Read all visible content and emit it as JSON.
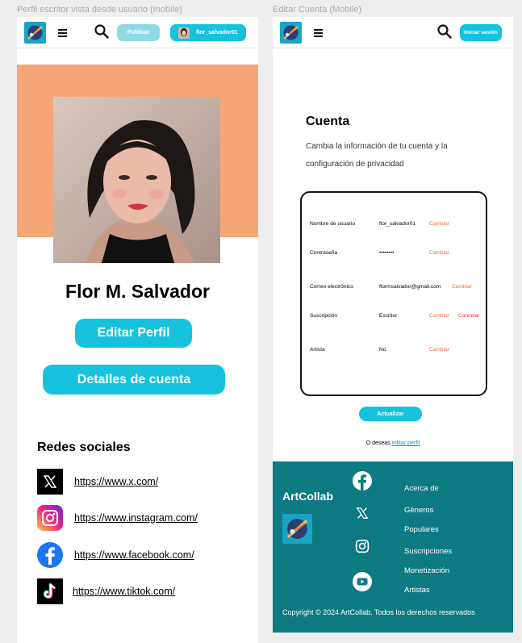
{
  "frames": {
    "profile_title": "Perfil escritor vista desde usuario (mobile)",
    "account_title": "Editar Cuenta (Mobile)"
  },
  "colors": {
    "accent": "#16c2dd",
    "cover": "#f7a678",
    "footer": "#0d7a82",
    "link": "#e8733c"
  },
  "profile_page": {
    "header": {
      "publish_label": "Publicar",
      "username": "flor_salvador01"
    },
    "name": "Flor M. Salvador",
    "edit_profile_label": "Editar Perfil",
    "account_details_label": "Detalles de cuenta",
    "socials_title": "Redes sociales",
    "socials": [
      {
        "icon": "x-icon",
        "url": "https://www.x.com/"
      },
      {
        "icon": "instagram-icon",
        "url": "https://www.instagram.com/"
      },
      {
        "icon": "facebook-icon",
        "url": "https://www.facebook.com/"
      },
      {
        "icon": "tiktok-icon",
        "url": "https://www.tiktok.com/"
      }
    ]
  },
  "account_page": {
    "header": {
      "login_label": "Iniciar sesión"
    },
    "title": "Cuenta",
    "description": "Cambia la información de tu cuenta y la configuración de privacidad",
    "rows": [
      {
        "label": "Nombre de usuario",
        "value": "flor_salvador01",
        "action": "Cambiar"
      },
      {
        "label": "Contraseña",
        "value": "••••••••",
        "action": "Cambiar"
      },
      {
        "label": "Correo electrónico",
        "value": "flormsalvador@gmail.com",
        "action": "Cambiar"
      },
      {
        "label": "Suscripción",
        "value": "Escritor",
        "action": "Cambiar",
        "action2": "Cancelar"
      },
      {
        "label": "Artista",
        "value": "No",
        "action": "Cambiar"
      }
    ],
    "update_label": "Actualizar",
    "edit_prefix": "O deseas",
    "edit_link": "editar perfil",
    "footer": {
      "brand": "ArtCollab",
      "links": [
        "Acerca de",
        "Géneros",
        "Populares",
        "Suscripciones",
        "Monetización",
        "Artistas"
      ],
      "icons": [
        "facebook-icon",
        "x-icon",
        "instagram-icon",
        "youtube-icon"
      ],
      "copyright": "Copyright © 2024 ArtCollab.  Todos los derechos reservados"
    }
  }
}
